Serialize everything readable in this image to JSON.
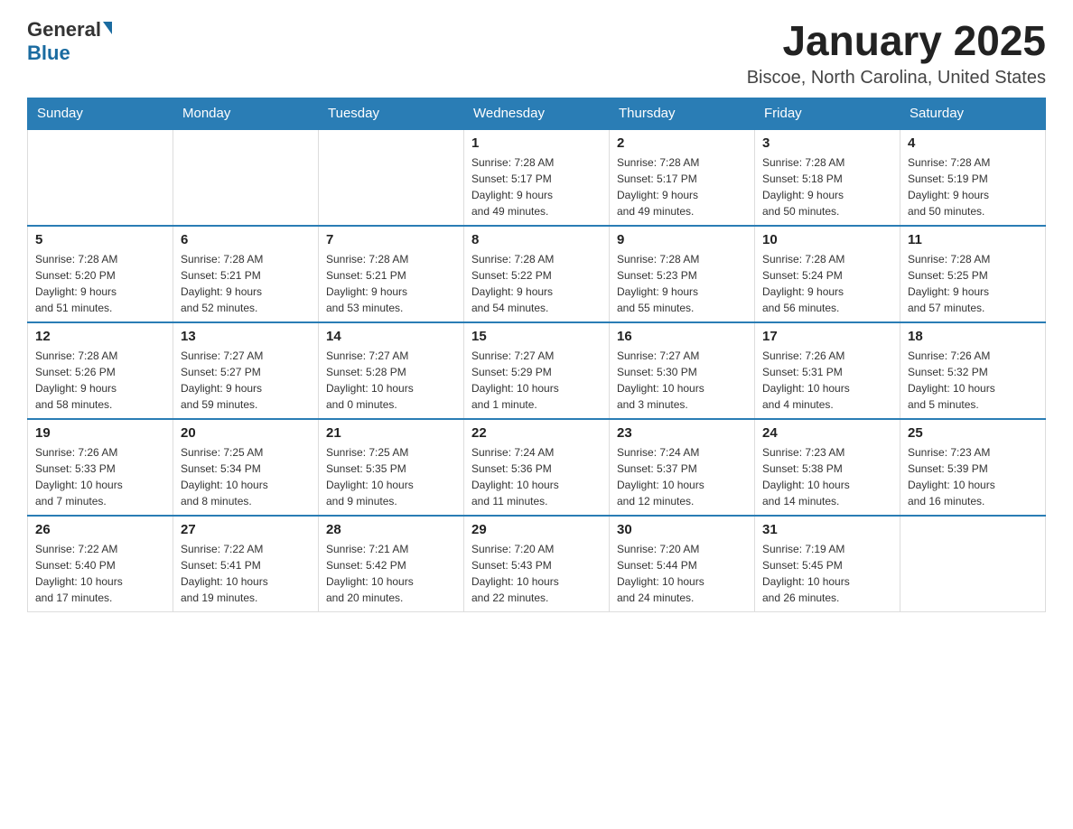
{
  "header": {
    "logo_general": "General",
    "logo_blue": "Blue",
    "main_title": "January 2025",
    "subtitle": "Biscoe, North Carolina, United States"
  },
  "days_of_week": [
    "Sunday",
    "Monday",
    "Tuesday",
    "Wednesday",
    "Thursday",
    "Friday",
    "Saturday"
  ],
  "weeks": [
    [
      {
        "day": "",
        "info": ""
      },
      {
        "day": "",
        "info": ""
      },
      {
        "day": "",
        "info": ""
      },
      {
        "day": "1",
        "info": "Sunrise: 7:28 AM\nSunset: 5:17 PM\nDaylight: 9 hours\nand 49 minutes."
      },
      {
        "day": "2",
        "info": "Sunrise: 7:28 AM\nSunset: 5:17 PM\nDaylight: 9 hours\nand 49 minutes."
      },
      {
        "day": "3",
        "info": "Sunrise: 7:28 AM\nSunset: 5:18 PM\nDaylight: 9 hours\nand 50 minutes."
      },
      {
        "day": "4",
        "info": "Sunrise: 7:28 AM\nSunset: 5:19 PM\nDaylight: 9 hours\nand 50 minutes."
      }
    ],
    [
      {
        "day": "5",
        "info": "Sunrise: 7:28 AM\nSunset: 5:20 PM\nDaylight: 9 hours\nand 51 minutes."
      },
      {
        "day": "6",
        "info": "Sunrise: 7:28 AM\nSunset: 5:21 PM\nDaylight: 9 hours\nand 52 minutes."
      },
      {
        "day": "7",
        "info": "Sunrise: 7:28 AM\nSunset: 5:21 PM\nDaylight: 9 hours\nand 53 minutes."
      },
      {
        "day": "8",
        "info": "Sunrise: 7:28 AM\nSunset: 5:22 PM\nDaylight: 9 hours\nand 54 minutes."
      },
      {
        "day": "9",
        "info": "Sunrise: 7:28 AM\nSunset: 5:23 PM\nDaylight: 9 hours\nand 55 minutes."
      },
      {
        "day": "10",
        "info": "Sunrise: 7:28 AM\nSunset: 5:24 PM\nDaylight: 9 hours\nand 56 minutes."
      },
      {
        "day": "11",
        "info": "Sunrise: 7:28 AM\nSunset: 5:25 PM\nDaylight: 9 hours\nand 57 minutes."
      }
    ],
    [
      {
        "day": "12",
        "info": "Sunrise: 7:28 AM\nSunset: 5:26 PM\nDaylight: 9 hours\nand 58 minutes."
      },
      {
        "day": "13",
        "info": "Sunrise: 7:27 AM\nSunset: 5:27 PM\nDaylight: 9 hours\nand 59 minutes."
      },
      {
        "day": "14",
        "info": "Sunrise: 7:27 AM\nSunset: 5:28 PM\nDaylight: 10 hours\nand 0 minutes."
      },
      {
        "day": "15",
        "info": "Sunrise: 7:27 AM\nSunset: 5:29 PM\nDaylight: 10 hours\nand 1 minute."
      },
      {
        "day": "16",
        "info": "Sunrise: 7:27 AM\nSunset: 5:30 PM\nDaylight: 10 hours\nand 3 minutes."
      },
      {
        "day": "17",
        "info": "Sunrise: 7:26 AM\nSunset: 5:31 PM\nDaylight: 10 hours\nand 4 minutes."
      },
      {
        "day": "18",
        "info": "Sunrise: 7:26 AM\nSunset: 5:32 PM\nDaylight: 10 hours\nand 5 minutes."
      }
    ],
    [
      {
        "day": "19",
        "info": "Sunrise: 7:26 AM\nSunset: 5:33 PM\nDaylight: 10 hours\nand 7 minutes."
      },
      {
        "day": "20",
        "info": "Sunrise: 7:25 AM\nSunset: 5:34 PM\nDaylight: 10 hours\nand 8 minutes."
      },
      {
        "day": "21",
        "info": "Sunrise: 7:25 AM\nSunset: 5:35 PM\nDaylight: 10 hours\nand 9 minutes."
      },
      {
        "day": "22",
        "info": "Sunrise: 7:24 AM\nSunset: 5:36 PM\nDaylight: 10 hours\nand 11 minutes."
      },
      {
        "day": "23",
        "info": "Sunrise: 7:24 AM\nSunset: 5:37 PM\nDaylight: 10 hours\nand 12 minutes."
      },
      {
        "day": "24",
        "info": "Sunrise: 7:23 AM\nSunset: 5:38 PM\nDaylight: 10 hours\nand 14 minutes."
      },
      {
        "day": "25",
        "info": "Sunrise: 7:23 AM\nSunset: 5:39 PM\nDaylight: 10 hours\nand 16 minutes."
      }
    ],
    [
      {
        "day": "26",
        "info": "Sunrise: 7:22 AM\nSunset: 5:40 PM\nDaylight: 10 hours\nand 17 minutes."
      },
      {
        "day": "27",
        "info": "Sunrise: 7:22 AM\nSunset: 5:41 PM\nDaylight: 10 hours\nand 19 minutes."
      },
      {
        "day": "28",
        "info": "Sunrise: 7:21 AM\nSunset: 5:42 PM\nDaylight: 10 hours\nand 20 minutes."
      },
      {
        "day": "29",
        "info": "Sunrise: 7:20 AM\nSunset: 5:43 PM\nDaylight: 10 hours\nand 22 minutes."
      },
      {
        "day": "30",
        "info": "Sunrise: 7:20 AM\nSunset: 5:44 PM\nDaylight: 10 hours\nand 24 minutes."
      },
      {
        "day": "31",
        "info": "Sunrise: 7:19 AM\nSunset: 5:45 PM\nDaylight: 10 hours\nand 26 minutes."
      },
      {
        "day": "",
        "info": ""
      }
    ]
  ]
}
